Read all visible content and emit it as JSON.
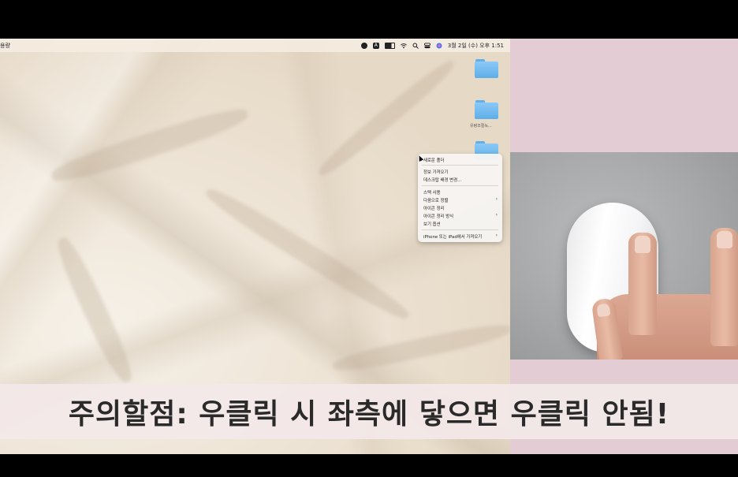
{
  "menubar": {
    "left_label": "용량",
    "status_icons": [
      "record-icon",
      "a-icon",
      "battery-icon",
      "wifi-icon",
      "search-icon",
      "control-center-icon",
      "siri-icon"
    ],
    "clock": "3월 2일 (수) 오후 1:51"
  },
  "desktop_icons": [
    {
      "icon": "folder-icon",
      "label": ""
    },
    {
      "icon": "folder-icon",
      "label": "유량조절녹..."
    },
    {
      "icon": "folder-icon",
      "label": ""
    }
  ],
  "context_menu": {
    "items": [
      {
        "label": "새로운 폴더",
        "submenu": false
      },
      {
        "label": "정보 가져오기",
        "submenu": false
      },
      {
        "label": "데스크탑 배경 변경...",
        "submenu": false
      },
      {
        "label": "스택 사용",
        "submenu": false
      },
      {
        "label": "다음으로 정렬",
        "submenu": true
      },
      {
        "label": "아이콘 정리",
        "submenu": false
      },
      {
        "label": "아이콘 정리 방식",
        "submenu": true
      },
      {
        "label": "보기 옵션",
        "submenu": false
      },
      {
        "label": "iPhone 또는 iPad에서 가져오기",
        "submenu": true
      }
    ],
    "submenu_arrow": "›"
  },
  "caption": {
    "text": "주의할점: 우클릭 시 좌측에 닿으면 우클릭 안됨!"
  },
  "colors": {
    "pink_panel": "#e4ccd4",
    "folder": "#6cb7ef",
    "caption_text": "#2a2a2a"
  }
}
